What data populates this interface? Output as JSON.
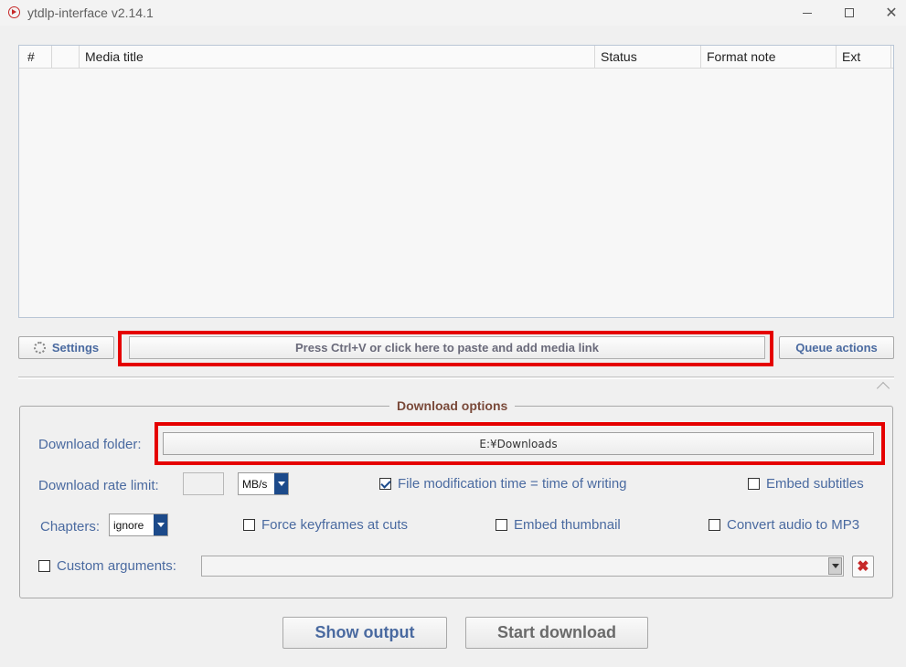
{
  "window": {
    "title": "ytdlp-interface v2.14.1",
    "icon": "play-circle-icon",
    "controls": [
      "minimize-icon",
      "maximize-icon",
      "close-icon"
    ]
  },
  "media_list": {
    "columns": [
      "#",
      "",
      "Media title",
      "Status",
      "Format note",
      "Ext"
    ],
    "rows": []
  },
  "toolbar": {
    "settings_label": "Settings",
    "settings_icon": "gear-icon",
    "paste_label": "Press Ctrl+V or click here to paste and add media link",
    "queue_label": "Queue actions"
  },
  "options": {
    "legend": "Download options",
    "folder_label": "Download folder:",
    "folder_value": "E:¥Downloads",
    "rate_label": "Download rate limit:",
    "rate_value": "",
    "rate_unit": "MB/s",
    "chapters_label": "Chapters:",
    "chapters_value": "ignore",
    "file_mod_time": {
      "label": "File modification time = time of writing",
      "checked": true
    },
    "embed_subtitles": {
      "label": "Embed subtitles",
      "checked": false
    },
    "force_keyframes": {
      "label": "Force keyframes at cuts",
      "checked": false
    },
    "embed_thumbnail": {
      "label": "Embed thumbnail",
      "checked": false
    },
    "convert_mp3": {
      "label": "Convert audio to MP3",
      "checked": false
    },
    "custom_args": {
      "label": "Custom arguments:",
      "checked": false,
      "value": ""
    },
    "clear_icon": "x-icon"
  },
  "actions": {
    "show_output": "Show output",
    "start_download": "Start download"
  },
  "colors": {
    "accent_text": "#4a6aa0",
    "legend_text": "#7a4a3a",
    "highlight": "#e50000",
    "combo_arrow": "#1c4a8a"
  }
}
